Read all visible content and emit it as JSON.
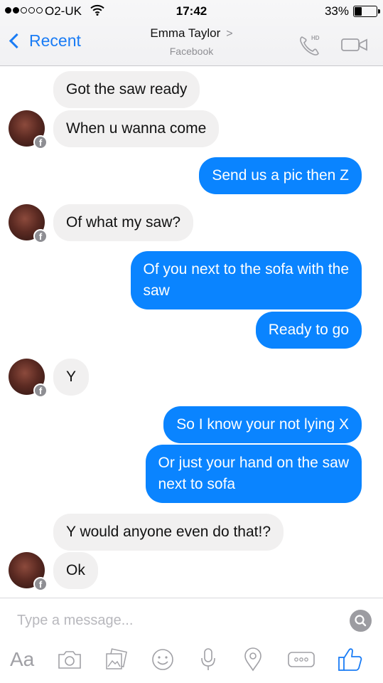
{
  "status_bar": {
    "carrier": "O2-UK",
    "time": "17:42",
    "battery_percent_label": "33%",
    "battery_level": 0.33,
    "signal_bars_filled": 2,
    "signal_bars_total": 5
  },
  "header": {
    "back_label": "Recent",
    "contact_name": "Emma Taylor",
    "contact_chevron": ">",
    "subtitle": "Facebook",
    "call_badge": "HD",
    "icons": [
      "back-chevron-icon",
      "phone-hd-icon",
      "video-camera-icon"
    ]
  },
  "messages": [
    {
      "from": "them",
      "text": "Got the saw ready"
    },
    {
      "from": "them",
      "text": "When u wanna come",
      "avatar": true
    },
    {
      "from": "me",
      "text": "Send us a pic then Z"
    },
    {
      "from": "them",
      "text": "Of what my saw?",
      "avatar": true
    },
    {
      "from": "me",
      "lines": [
        "Of you next to the sofa with the",
        "saw"
      ]
    },
    {
      "from": "me",
      "text": "Ready to go"
    },
    {
      "from": "them",
      "text": "Y",
      "avatar": true
    },
    {
      "from": "me",
      "text": "So I know your not lying X"
    },
    {
      "from": "me",
      "lines": [
        "Or just your hand on the saw",
        "next to sofa"
      ]
    },
    {
      "from": "them",
      "text": "Y would anyone even do that!?"
    },
    {
      "from": "them",
      "text": "Ok",
      "avatar": true
    }
  ],
  "composer": {
    "placeholder": "Type a message...",
    "text_button": "Aa",
    "toolbar_icons": [
      "text-format-icon",
      "camera-icon",
      "gallery-icon",
      "emoji-icon",
      "microphone-icon",
      "location-pin-icon",
      "more-icon",
      "thumbs-up-icon"
    ]
  },
  "colors": {
    "accent": "#0a84ff",
    "incoming_bubble": "#f1f0f0",
    "icon_gray": "#a0a0a5"
  }
}
